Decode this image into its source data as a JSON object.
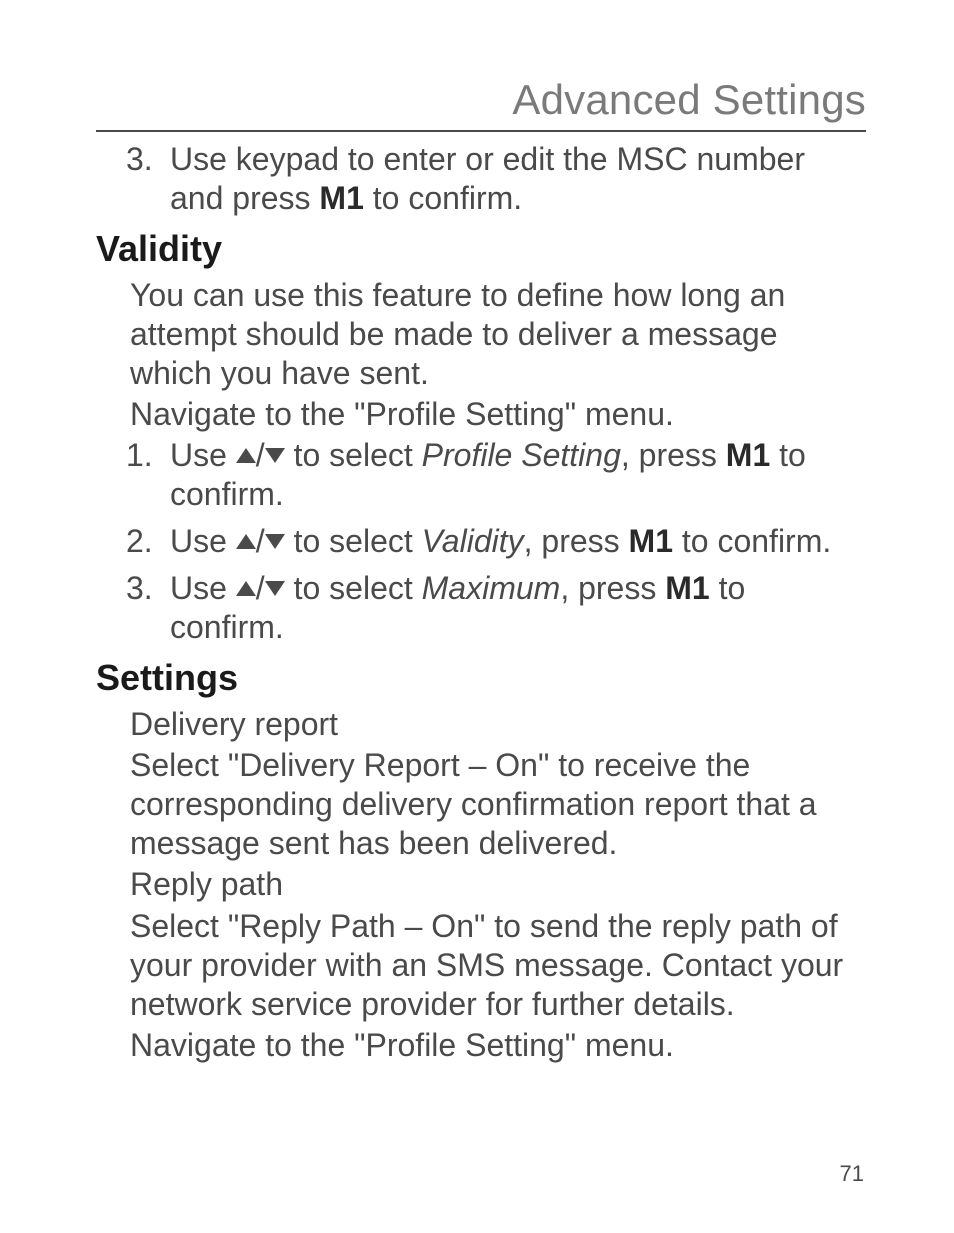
{
  "chapter_title": "Advanced Settings",
  "intro_step": {
    "num": "3.",
    "part1": "Use keypad to enter or edit the MSC number and press ",
    "m1": "M1",
    "part2": " to confirm."
  },
  "validity": {
    "heading": "Validity",
    "body1": "You can use this feature to define how long an attempt should be made to deliver a message which you have sent.",
    "body2": "Navigate to the \"Profile Setting\" menu.",
    "steps": [
      {
        "num": "1.",
        "pre": "Use ",
        "mid": " to select ",
        "italic": "Profile Setting",
        "post1": ", press ",
        "m1": "M1",
        "post2": " to confirm."
      },
      {
        "num": "2.",
        "pre": "Use ",
        "mid": " to select ",
        "italic": "Validity",
        "post1": ", press ",
        "m1": "M1",
        "post2": " to confirm."
      },
      {
        "num": "3.",
        "pre": "Use ",
        "mid": " to select ",
        "italic": "Maximum",
        "post1": ", press ",
        "m1": "M1",
        "post2": " to confirm."
      }
    ]
  },
  "settings": {
    "heading": "Settings",
    "sub1": "Delivery report",
    "body1": "Select \"Delivery Report – On\" to receive the corresponding delivery confirmation report that a message sent has been delivered.",
    "sub2": "Reply path",
    "body2": "Select \"Reply Path – On\" to send the reply path of your provider with an SMS message. Contact your network service provider for further details.",
    "body3": "Navigate to the \"Profile Setting\" menu."
  },
  "page_number": "71"
}
